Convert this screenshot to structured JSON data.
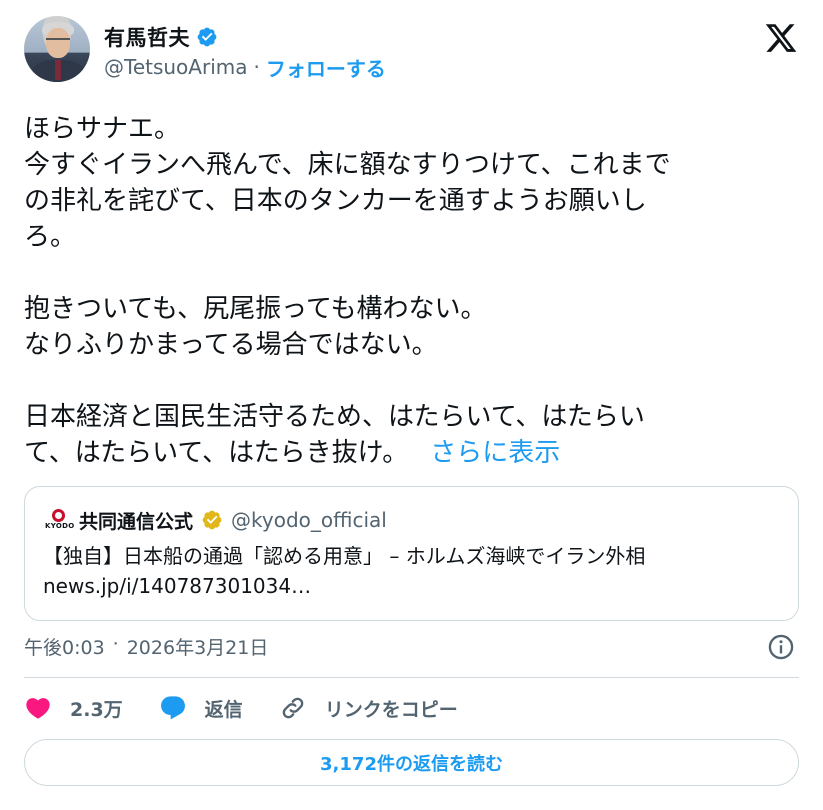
{
  "author": {
    "display_name": "有馬哲夫",
    "handle": "@TetsuoArima",
    "separator": "·",
    "follow_label": "フォローする"
  },
  "tweet": {
    "lines": [
      "ほらサナエ。",
      "今すぐイランへ飛んで、床に額なすりつけて、これまで",
      "の非礼を詫びて、日本のタンカーを通すようお願いし",
      "ろ。",
      "",
      "抱きついても、尻尾振っても構わない。",
      "なりふりかまってる場合ではない。",
      "",
      "日本経済と国民生活守るため、はたらいて、はたらい",
      "て、はたらいて、はたらき抜け。"
    ],
    "show_more": "さらに表示"
  },
  "quote": {
    "logo_text": "KYODO",
    "name": "共同通信公式",
    "handle": "@kyodo_official",
    "line1": "【独自】日本船の通過「認める用意」 – ホルムズ海峡でイラン外相",
    "line2": "news.jp/i/140787301034…"
  },
  "meta": {
    "time": "午後0:03",
    "separator": "·",
    "date": "2026年3月21日"
  },
  "actions": {
    "likes": "2.3万",
    "reply": "返信",
    "copy_link": "リンクをコピー"
  },
  "read_replies": "3,172件の返信を読む",
  "colors": {
    "accent": "#1d9bf0",
    "like": "#f91880",
    "muted": "#536471",
    "border": "#cfd9de",
    "gold_badge": "#e2b719"
  }
}
